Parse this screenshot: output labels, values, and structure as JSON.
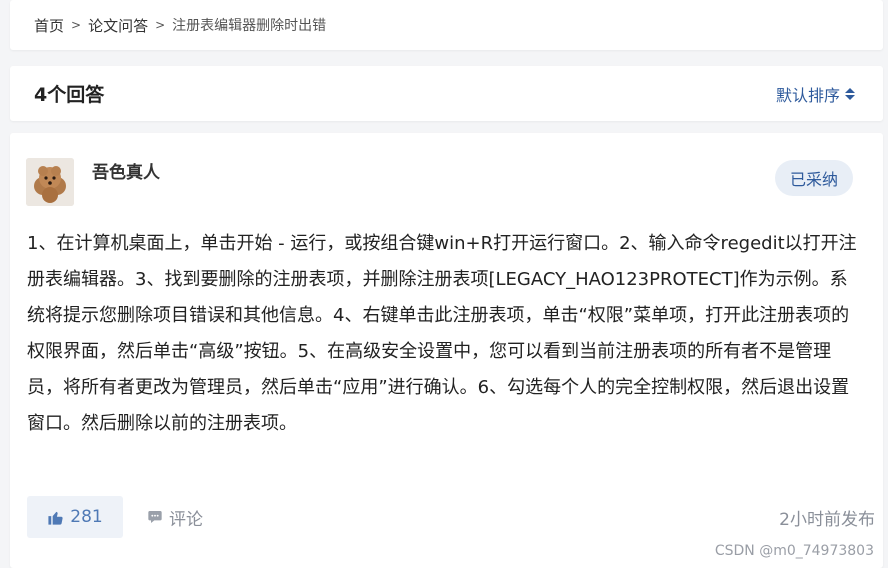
{
  "breadcrumb": {
    "home": "首页",
    "category": "论文问答",
    "current": "注册表编辑器删除时出错",
    "separator": ">"
  },
  "answers_header": {
    "count_label": "4个回答",
    "sort_label": "默认排序"
  },
  "answer": {
    "username": "吾色真人",
    "adopted_badge": "已采纳",
    "content": "1、在计算机桌面上，单击开始 - 运行，或按组合键win+R打开运行窗口。2、输入命令regedit以打开注册表编辑器。3、找到要删除的注册表项，并删除注册表项[LEGACY_HAO123PROTECT]作为示例。系统将提示您删除项目错误和其他信息。4、右键单击此注册表项，单击“权限”菜单项，打开此注册表项的权限界面，然后单击“高级”按钮。5、在高级安全设置中，您可以看到当前注册表项的所有者不是管理员，将所有者更改为管理员，然后单击“应用”进行确认。6、勾选每个人的完全控制权限，然后退出设置窗口。然后删除以前的注册表项。",
    "like_count": "281",
    "comment_label": "评论",
    "time": "2小时前发布"
  },
  "watermark": "CSDN @m0_74973803",
  "colors": {
    "accent": "#2e5a9c",
    "like": "#4f79b5",
    "muted": "#8a8f99",
    "page_bg": "#f4f5f7"
  },
  "icons": {
    "sort": "sort-caret-icon",
    "like": "thumbs-up-icon",
    "comment": "comment-bubble-icon",
    "avatar": "poodle-avatar"
  }
}
